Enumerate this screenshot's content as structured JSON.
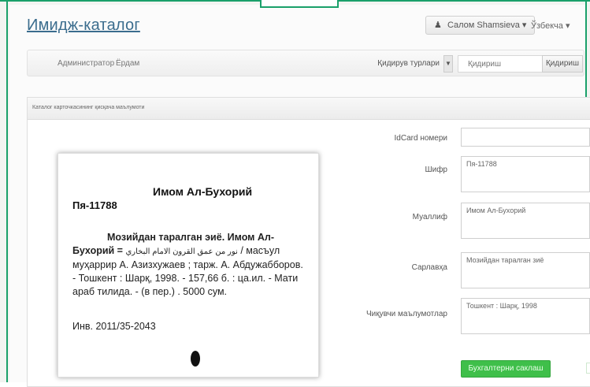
{
  "header": {
    "brand": "Имидж-каталог",
    "user": "Салом Shamsieva",
    "user_caret": "▾",
    "language": "Ўзбекча",
    "language_caret": "▾"
  },
  "nav": {
    "links": [
      "Администратор",
      "Ёрдам"
    ],
    "search_type": "Қидирув турлари",
    "search_placeholder": "Қидириш",
    "search_button": "Қидириш"
  },
  "panel": {
    "title": "Каталог карточкасининг қисқача маълумоти"
  },
  "card": {
    "title": "Имом Ал-Бухорий",
    "shifr": "Пя-11788",
    "bold_title": "Мозийдан тарал­ган эиё. Имом Ал-",
    "line2_bold": "Бухорий = ",
    "line2_arabic": "نور من عمق القرون الامام البخاري",
    "line2_rest": " / масъул",
    "line3": "муҳаррир А. Азизхужаев ; тарж. А. Абдужабборов.",
    "line4": "- Тошкент : Шарқ, 1998. - 157,66 б. : ца.ил. - Мати",
    "line5": "араб тилида. - (в пер.) . 5000 сум.",
    "inventory": "Инв. 2011/35-2043"
  },
  "form": {
    "idcard_label": "IdCard номери",
    "idcard_value": "",
    "shifr_label": "Шифр",
    "shifr_value": "Пя-11788",
    "author_label": "Муаллиф",
    "author_value": "Имом Ал-Бухорий",
    "title_label": "Сарлавҳа",
    "title_value": "Мозийдан таралган зиё",
    "pub_label": "Чиқувчи маълумотлар",
    "pub_value": "Тошкент : Шарқ, 1998",
    "save_button": "Бухгалтерни саклаш"
  },
  "colors": {
    "frame": "#1aa06a",
    "brand": "#3b6d8e",
    "save": "#3fbf4a"
  }
}
